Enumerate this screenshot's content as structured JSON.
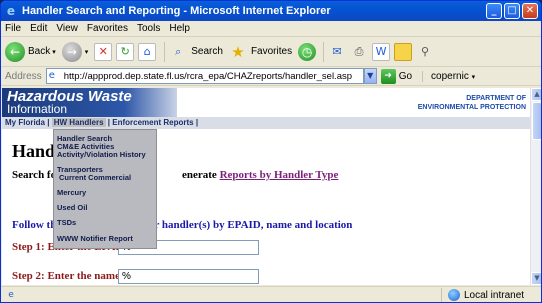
{
  "window": {
    "title": "Handler Search and Reporting - Microsoft Internet Explorer"
  },
  "menubar": [
    "File",
    "Edit",
    "View",
    "Favorites",
    "Tools",
    "Help"
  ],
  "toolbar": {
    "back_label": "Back",
    "search_label": "Search",
    "favorites_label": "Favorites"
  },
  "address": {
    "label": "Address",
    "url": "http://appprod.dep.state.fl.us/rcra_epa/CHAZreports/handler_sel.asp",
    "go_label": "Go",
    "search_engine": "copernic"
  },
  "page": {
    "banner": {
      "title": "Hazardous Waste",
      "subtitle": "Information",
      "dept_line1": "DEPARTMENT OF",
      "dept_line2": "ENVIRONMENTAL PROTECTION"
    },
    "nav": {
      "item1": "My Florida",
      "item2": "HW Handlers",
      "item3": "Enforcement Reports",
      "sep": "|"
    },
    "dropdown": [
      "Handler Search",
      "CM&E Activities",
      "Activity/Violation History",
      "Transporters",
      "Current Commercial",
      "Mercury",
      "Used Oil",
      "TSDs",
      "WWW Notifier Report"
    ],
    "title": "Handl",
    "intro_left": "Search fo",
    "intro_right_prefix": "enerate",
    "intro_link": "Reports by Handler Type",
    "follow_left": "Follow the",
    "follow_right": "or handler(s) by EPAID, name and location",
    "step1_label": "Step 1: Enter the EPAID :",
    "step1_value": "%",
    "step2_label": "Step 2: Enter the name :",
    "step2_value": "%"
  },
  "status": {
    "zone": "Local intranet"
  }
}
